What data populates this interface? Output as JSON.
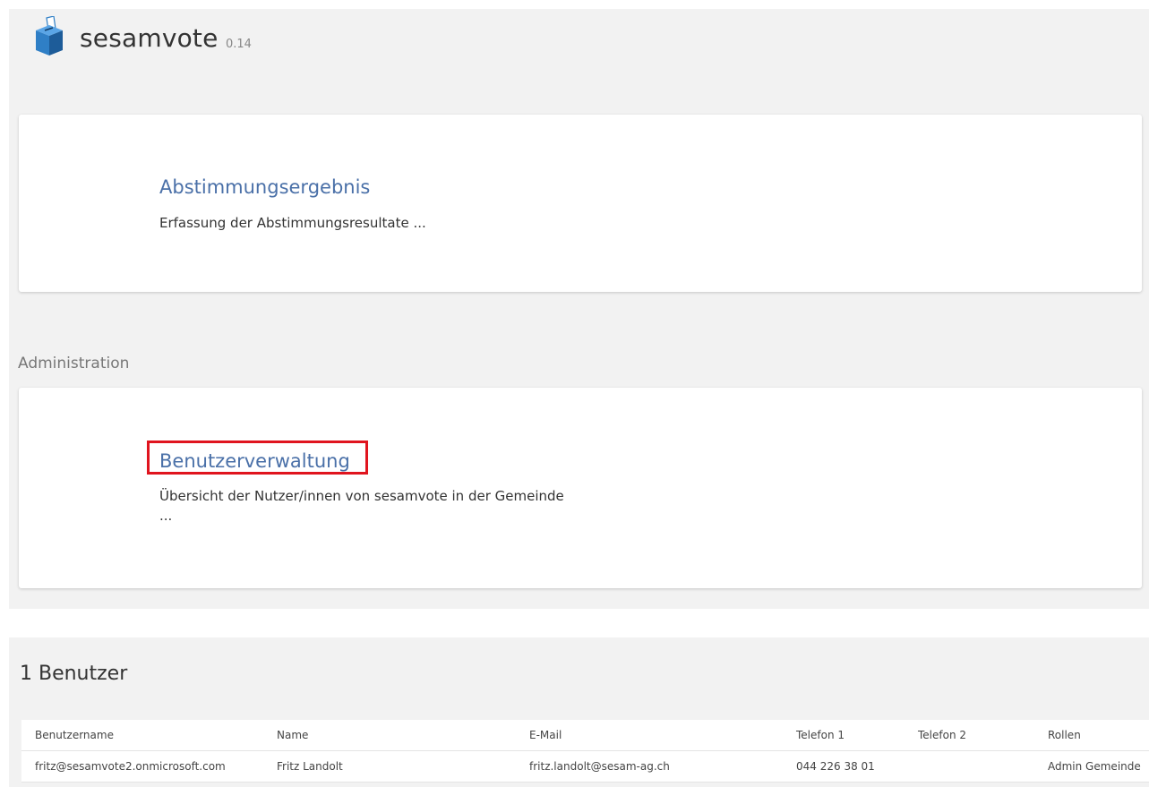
{
  "header": {
    "app_name": "sesamvote",
    "version": "0.14",
    "logo_icon": "ballot-box-icon"
  },
  "cards": [
    {
      "title": "Abstimmungsergebnis",
      "description": "Erfassung der Abstimmungsresultate ..."
    },
    {
      "title": "Benutzerverwaltung",
      "description": "Übersicht der Nutzer/innen von sesamvote in der Gemeinde ..."
    }
  ],
  "administration": {
    "heading": "Administration"
  },
  "users": {
    "heading": "1 Benutzer",
    "columns": [
      "Benutzername",
      "Name",
      "E-Mail",
      "Telefon 1",
      "Telefon 2",
      "Rollen"
    ],
    "rows": [
      [
        "fritz@sesamvote2.onmicrosoft.com",
        "Fritz Landolt",
        "fritz.landolt@sesam-ag.ch",
        "044 226 38 01",
        "",
        "Admin Gemeinde"
      ]
    ]
  },
  "colors": {
    "link": "#4a70a8",
    "highlight": "#e0141e",
    "panel_bg": "#f2f2f2",
    "logo_blue": "#2f7fc6"
  }
}
